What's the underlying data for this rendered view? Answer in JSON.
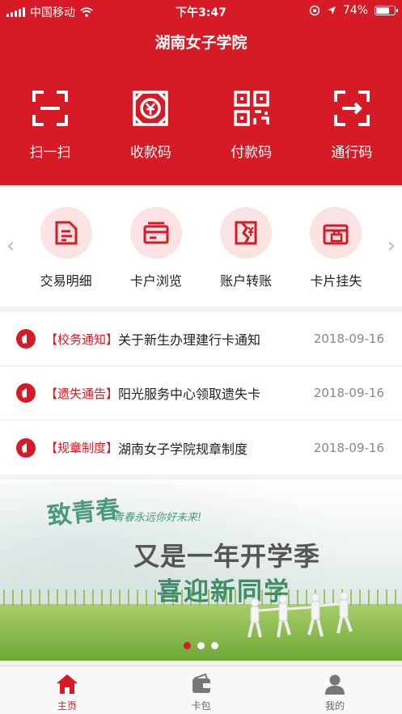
{
  "status_bar": {
    "carrier": "中国移动",
    "time": "下午3:47",
    "battery": "74%",
    "battery_level": 0.74
  },
  "header": {
    "title": "湖南女子学院"
  },
  "quick_actions": [
    {
      "label": "扫一扫",
      "icon": "scan-icon"
    },
    {
      "label": "收款码",
      "icon": "receive-code-icon"
    },
    {
      "label": "付款码",
      "icon": "pay-code-icon"
    },
    {
      "label": "通行码",
      "icon": "pass-code-icon"
    }
  ],
  "menu": [
    {
      "label": "交易明细",
      "icon": "document-icon"
    },
    {
      "label": "卡户浏览",
      "icon": "card-icon"
    },
    {
      "label": "账户转账",
      "icon": "transfer-icon"
    },
    {
      "label": "卡片挂失",
      "icon": "lock-card-icon"
    }
  ],
  "nav": {
    "prev": "‹",
    "next": "›"
  },
  "news": [
    {
      "category": "【校务通知】",
      "title": "关于新生办理建行卡通知",
      "date": "2018-09-16"
    },
    {
      "category": "【遗失通告】",
      "title": "阳光服务中心领取遗失卡",
      "date": "2018-09-16"
    },
    {
      "category": "【规章制度】",
      "title": "湖南女子学院规章制度",
      "date": "2018-09-16"
    }
  ],
  "banner": {
    "brand": "致青春",
    "slogan": "青春永远你好未来!",
    "line1": "又是一年开学季",
    "line2": "喜迎新同学",
    "active_dot": 1,
    "dot_count": 3
  },
  "tabbar": [
    {
      "label": "主页",
      "icon": "home-icon",
      "active": true
    },
    {
      "label": "卡包",
      "icon": "wallet-icon",
      "active": false
    },
    {
      "label": "我的",
      "icon": "user-icon",
      "active": false
    }
  ],
  "colors": {
    "brand_red": "#d71b26",
    "pale_red": "#fbe2e3"
  }
}
